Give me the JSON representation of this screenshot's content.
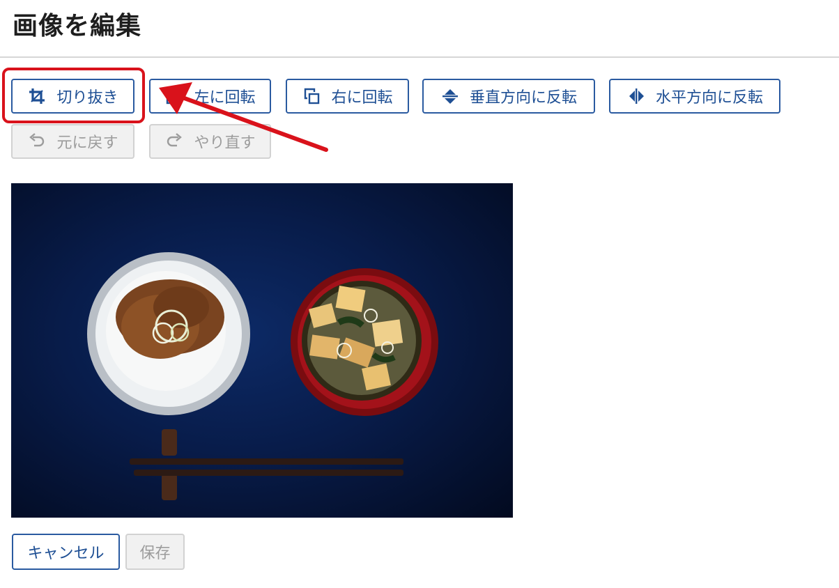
{
  "page": {
    "title": "画像を編集"
  },
  "toolbar": {
    "crop_label": "切り抜き",
    "rotate_left_label": "左に回転",
    "rotate_right_label": "右に回転",
    "flip_vertical_label": "垂直方向に反転",
    "flip_horizontal_label": "水平方向に反転",
    "undo_label": "元に戻す",
    "redo_label": "やり直す"
  },
  "icons": {
    "crop": "crop-icon",
    "rotate_left": "rotate-left-icon",
    "rotate_right": "rotate-right-icon",
    "flip_vertical": "flip-vertical-icon",
    "flip_horizontal": "flip-horizontal-icon",
    "undo": "undo-icon",
    "redo": "redo-icon"
  },
  "footer": {
    "cancel_label": "キャンセル",
    "save_label": "保存"
  },
  "colors": {
    "accent": "#2a5aa0",
    "highlight": "#d9121b",
    "disabled": "#9c9c9c"
  }
}
